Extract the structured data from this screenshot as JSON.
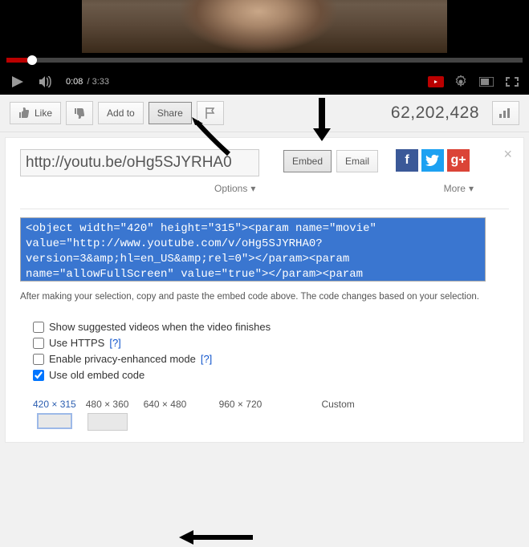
{
  "player": {
    "current_time": "0:08",
    "total_time": "3:33"
  },
  "actionbar": {
    "like_label": "Like",
    "addto_label": "Add to",
    "share_label": "Share",
    "views": "62,202,428"
  },
  "share": {
    "url_value": "http://youtu.be/oHg5SJYRHA0",
    "options_label": "Options",
    "embed_btn": "Embed",
    "email_btn": "Email",
    "more_label": "More",
    "embed_code": "<object width=\"420\" height=\"315\"><param name=\"movie\" value=\"http://www.youtube.com/v/oHg5SJYRHA0?version=3&amp;hl=en_US&amp;rel=0\"></param><param name=\"allowFullScreen\" value=\"true\"></param><param",
    "hint": "After making your selection, copy and paste the embed code above. The code changes based on your selection."
  },
  "options": {
    "show_suggested": {
      "label": "Show suggested videos when the video finishes",
      "checked": false
    },
    "use_https": {
      "label": "Use HTTPS",
      "checked": false,
      "help": "[?]"
    },
    "privacy": {
      "label": "Enable privacy-enhanced mode",
      "checked": false,
      "help": "[?]"
    },
    "old_embed": {
      "label": "Use old embed code",
      "checked": true
    }
  },
  "sizes": {
    "items": [
      {
        "label": "420 × 315"
      },
      {
        "label": "480 × 360"
      },
      {
        "label": "640 × 480"
      },
      {
        "label": "960 × 720"
      }
    ],
    "custom_label": "Custom"
  },
  "social": {
    "fb": "f",
    "tw": "t",
    "gp": "g+"
  }
}
